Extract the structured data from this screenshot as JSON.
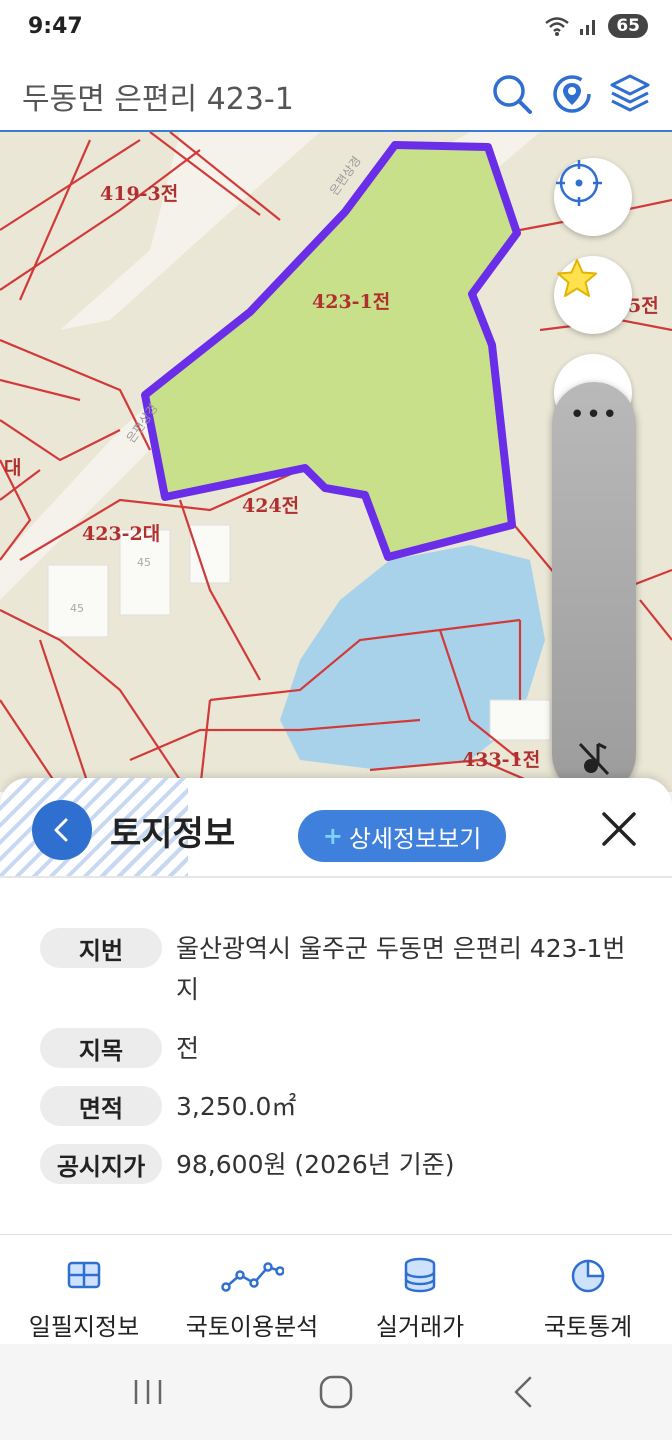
{
  "status": {
    "time": "9:47",
    "battery": "65"
  },
  "header": {
    "title": "두동면 은편리 423-1"
  },
  "map": {
    "parcel_labels": [
      "419-3전",
      "423-1전",
      "424전",
      "423-2대",
      "433-1전",
      "5전",
      "대"
    ],
    "road_label_1": "은편상경",
    "road_label_2": "은편상경",
    "building_labels": [
      "45",
      "45"
    ],
    "highlight_color": "#6a2ee8",
    "parcel_fill": "#c8e08a"
  },
  "sheet": {
    "title": "토지정보",
    "detail_button": "상세정보보기",
    "rows": [
      {
        "label": "지번",
        "value": "울산광역시 울주군 두동면 은편리 423-1번지"
      },
      {
        "label": "지목",
        "value": "전"
      },
      {
        "label": "면적",
        "value": "3,250.0㎡"
      },
      {
        "label": "공시지가",
        "value": "98,600원 (2026년 기준)"
      }
    ]
  },
  "nav": [
    {
      "label": "일필지정보",
      "icon": "grid-map-icon"
    },
    {
      "label": "국토이용분석",
      "icon": "line-graph-icon"
    },
    {
      "label": "실거래가",
      "icon": "database-icon"
    },
    {
      "label": "국토통계",
      "icon": "pie-chart-icon"
    }
  ],
  "colors": {
    "accent": "#2f6fd0",
    "parcel_border": "#d23a3a",
    "water": "#a8d2ea"
  }
}
